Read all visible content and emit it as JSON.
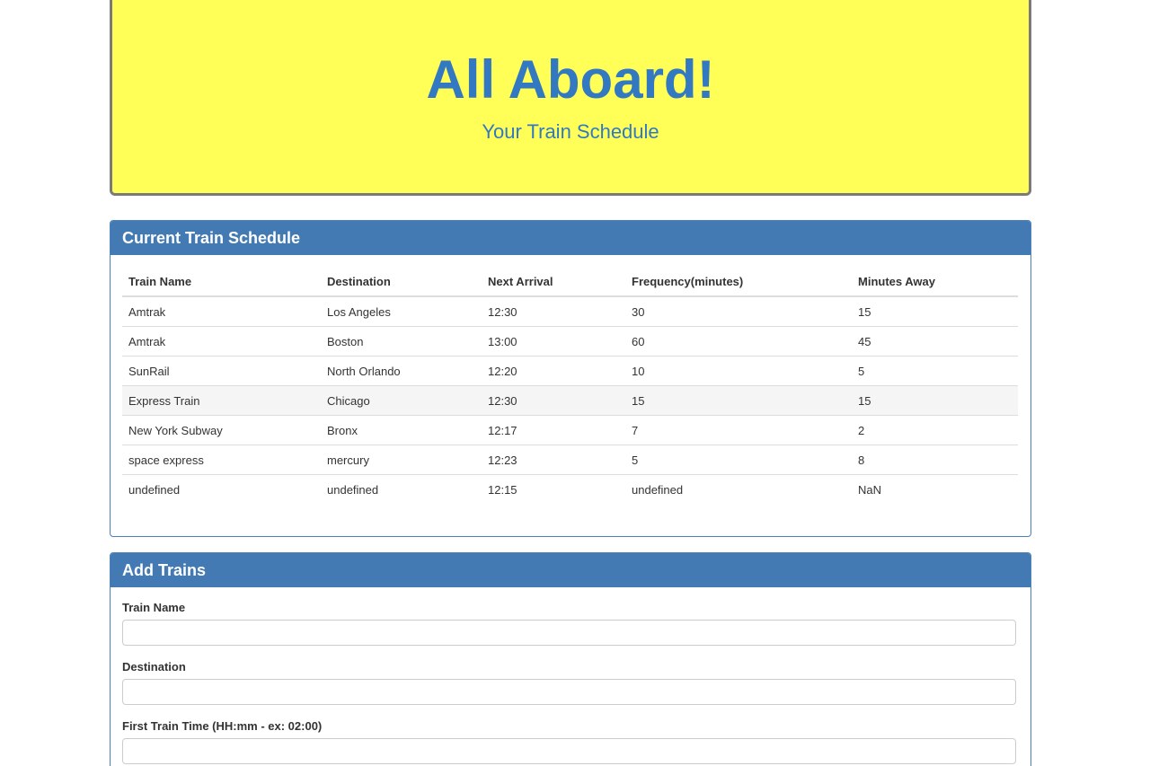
{
  "header": {
    "title": "All Aboard!",
    "subtitle": "Your Train Schedule"
  },
  "schedule": {
    "heading": "Current Train Schedule",
    "columns": [
      "Train Name",
      "Destination",
      "Next Arrival",
      "Frequency(minutes)",
      "Minutes Away"
    ],
    "rows": [
      [
        "Amtrak",
        "Los Angeles",
        "12:30",
        "30",
        "15"
      ],
      [
        "Amtrak",
        "Boston",
        "13:00",
        "60",
        "45"
      ],
      [
        "SunRail",
        "North Orlando",
        "12:20",
        "10",
        "5"
      ],
      [
        "Express Train",
        "Chicago",
        "12:30",
        "15",
        "15"
      ],
      [
        "New York Subway",
        "Bronx",
        "12:17",
        "7",
        "2"
      ],
      [
        "space express",
        "mercury",
        "12:23",
        "5",
        "8"
      ],
      [
        "undefined",
        "undefined",
        "12:15",
        "undefined",
        "NaN"
      ]
    ]
  },
  "add_trains": {
    "heading": "Add Trains",
    "fields": {
      "train_name": {
        "label": "Train Name",
        "value": ""
      },
      "destination": {
        "label": "Destination",
        "value": ""
      },
      "first_train_time": {
        "label": "First Train Time (HH:mm - ex: 02:00)",
        "value": ""
      }
    }
  },
  "colors": {
    "jumbotron_bg": "#ffff57",
    "title_text": "#3379c2",
    "panel_heading": "#437ab3"
  }
}
